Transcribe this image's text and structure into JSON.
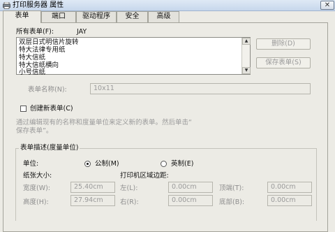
{
  "window": {
    "title": "打印服务器 属性",
    "close_glyph": "✕"
  },
  "tabs": [
    {
      "label": "表单"
    },
    {
      "label": "端口"
    },
    {
      "label": "驱动程序"
    },
    {
      "label": "安全"
    },
    {
      "label": "高级"
    }
  ],
  "forms": {
    "label": "所有表单(F):",
    "server": "JAY",
    "items": [
      "双层日式明信片旋转",
      "特大法律专用纸",
      "特大信纸",
      "特大信纸横向",
      "小号信纸"
    ],
    "selected_index": 4,
    "delete_label": "删除(D)",
    "save_label": "保存表单(S)"
  },
  "form_name": {
    "label": "表单名称(N):",
    "value": "10x11"
  },
  "create_form": {
    "label": "创建新表单(C)",
    "checked": false,
    "description_line1": "通过编辑现有的名称和度量单位来定义新的表单。然后单击“",
    "description_line2": "保存表单”。"
  },
  "form_description": {
    "legend": "表单描述(度量单位)",
    "units_label": "单位:",
    "metric_label": "公制(M)",
    "english_label": "英制(E)",
    "selected_unit": "metric",
    "paper_size_label": "纸张大小:",
    "margins_label": "打印机区域边距:",
    "width_label": "宽度(W):",
    "width_value": "25.40cm",
    "height_label": "高度(H):",
    "height_value": "27.94cm",
    "left_label": "左(L):",
    "left_value": "0.00cm",
    "right_label": "右(R):",
    "right_value": "0.00cm",
    "top_label": "顶端(T):",
    "top_value": "0.00cm",
    "bottom_label": "底部(B):",
    "bottom_value": "0.00cm"
  },
  "icons": {
    "titlebar": "printer-icon",
    "scroll_up": "arrow-up-icon",
    "scroll_down": "arrow-down-icon"
  },
  "colors": {
    "dialog_bg": "#ecebe5",
    "disabled_text": "#9a9a9a",
    "titlebar_gradient_top": "#dfe9f5",
    "titlebar_gradient_bottom": "#c7d7ec"
  }
}
